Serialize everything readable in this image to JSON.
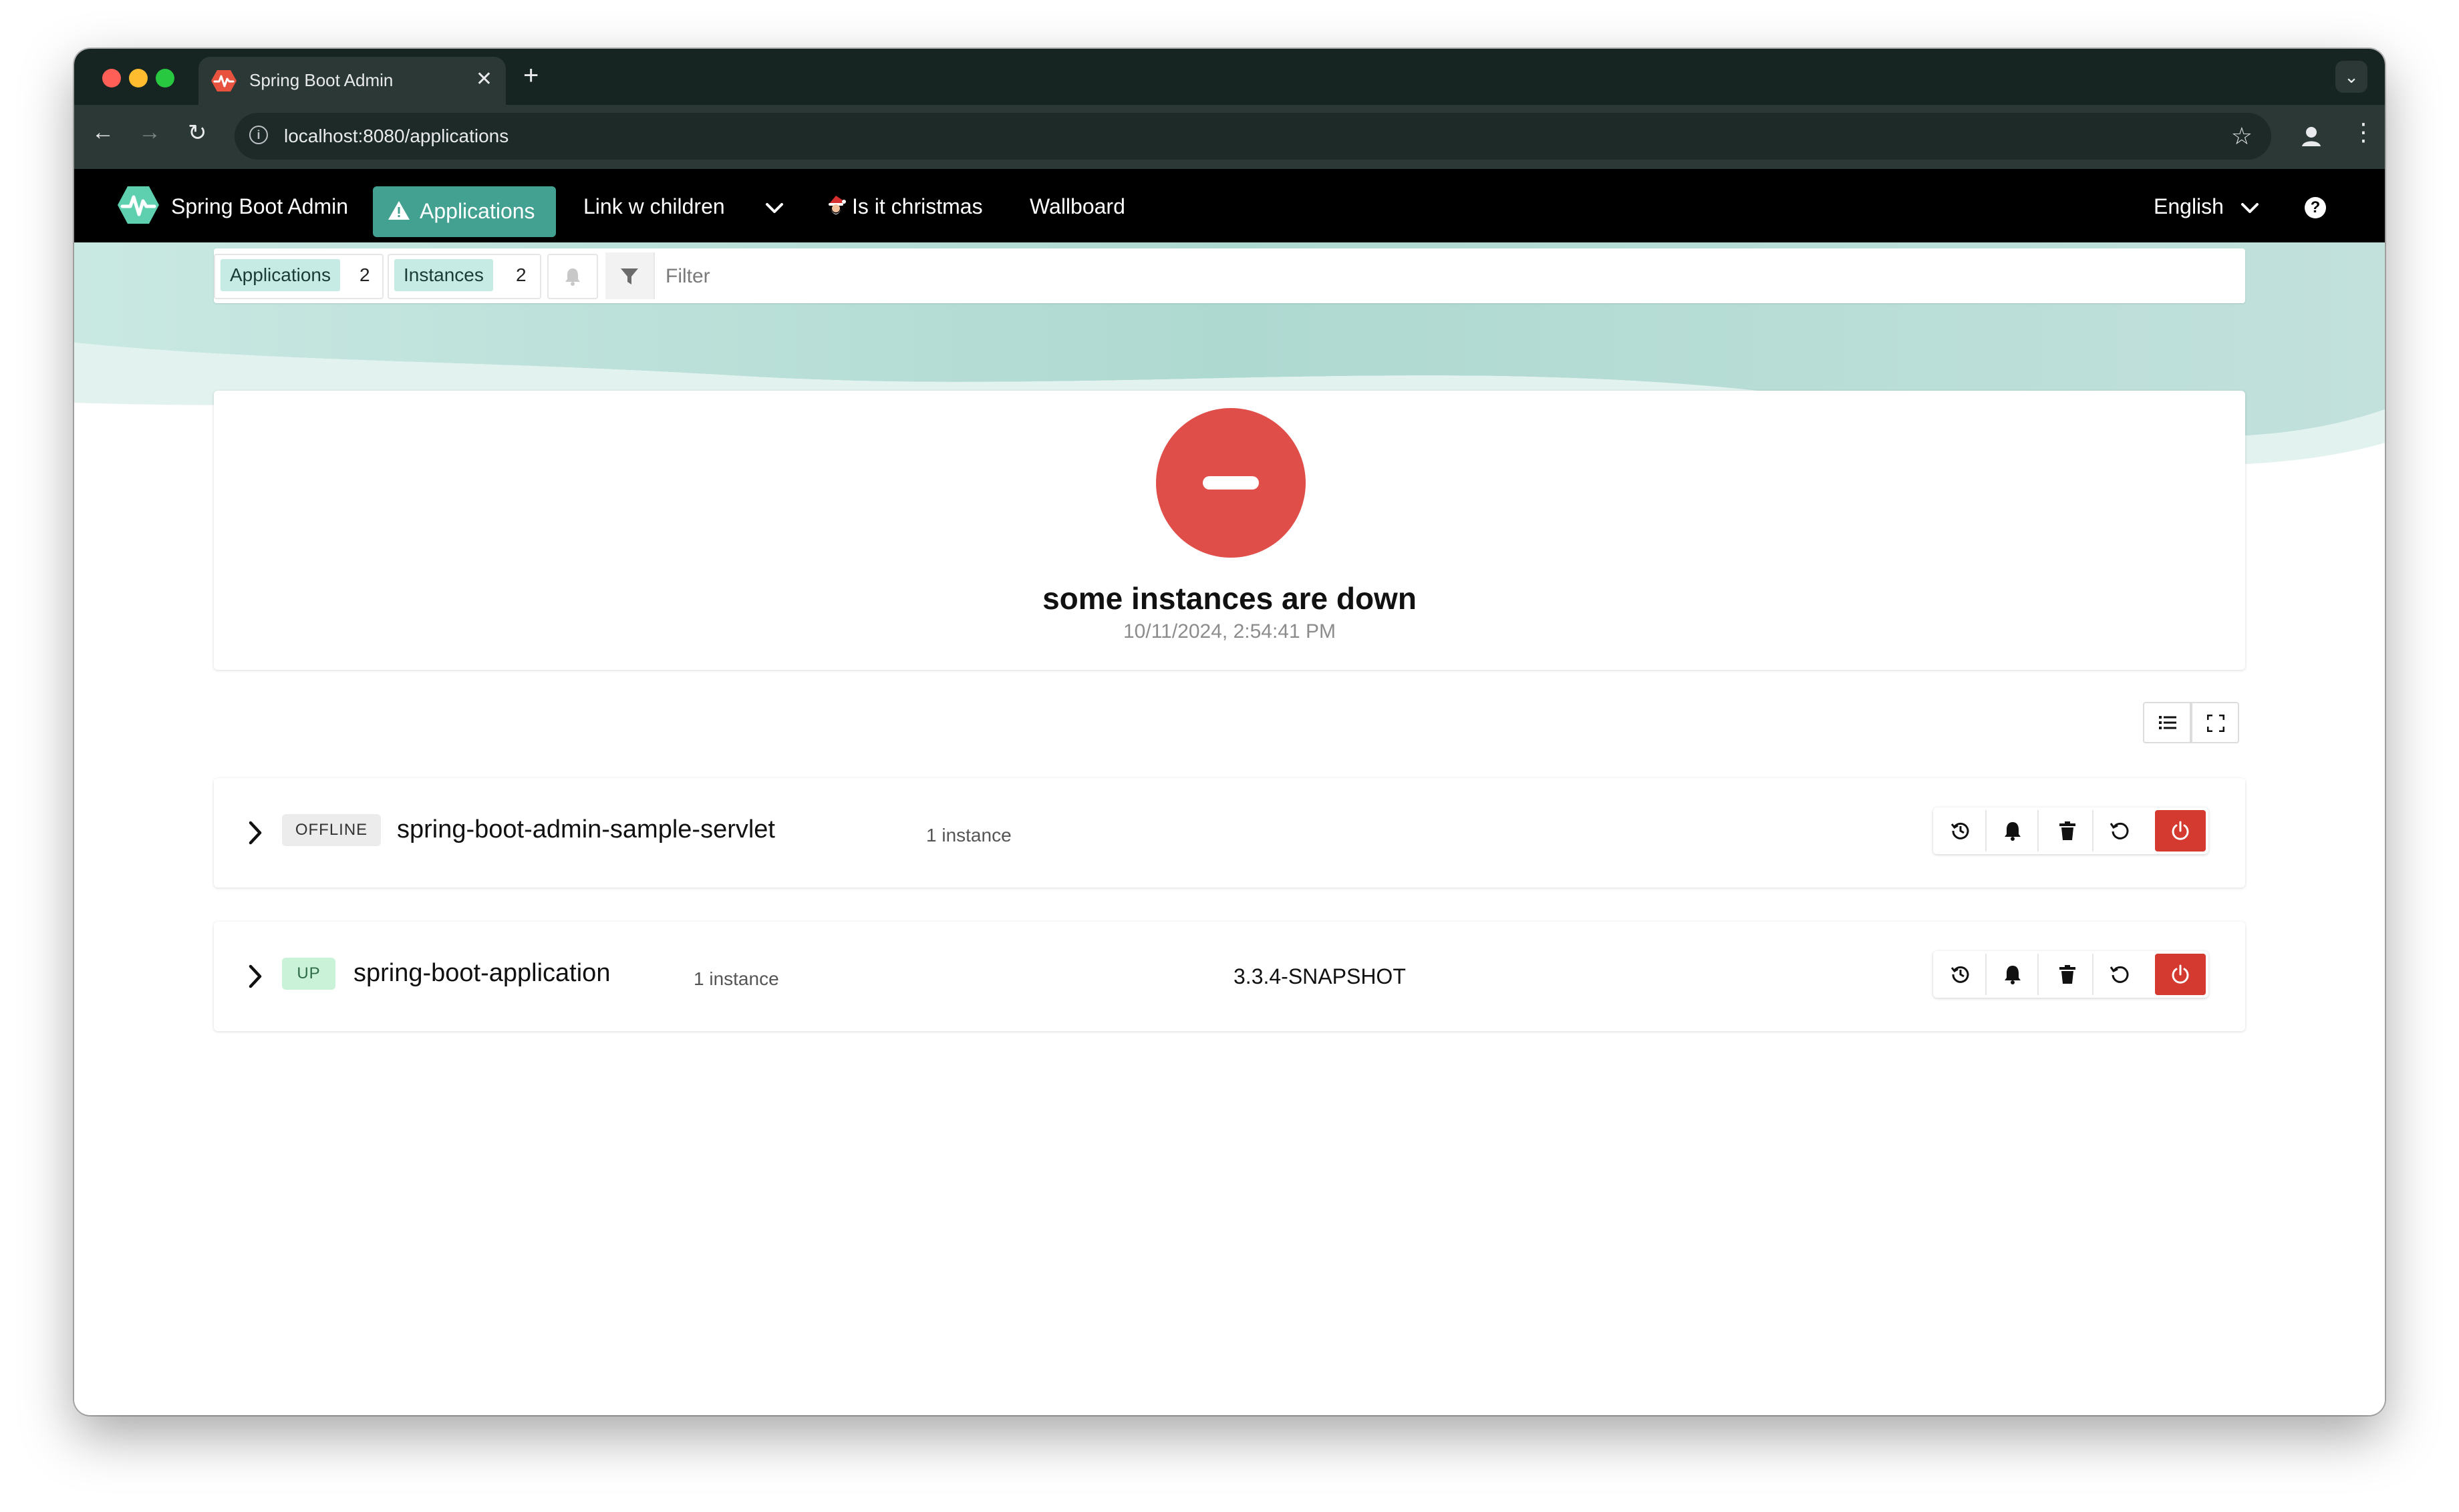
{
  "browser": {
    "tab_title": "Spring Boot Admin",
    "new_tab_label": "+",
    "url": "localhost:8080/applications"
  },
  "nav": {
    "brand": "Spring Boot Admin",
    "items": [
      {
        "label": "Applications",
        "active": true
      },
      {
        "label": "Link w children"
      },
      {
        "label": "Is it christmas"
      },
      {
        "label": "Wallboard"
      }
    ],
    "language": "English",
    "accent_color": "#42a191"
  },
  "filterbar": {
    "applications_label": "Applications",
    "applications_count": "2",
    "instances_label": "Instances",
    "instances_count": "2",
    "filter_placeholder": "Filter"
  },
  "status": {
    "title": "some instances are down",
    "timestamp": "10/11/2024, 2:54:41 PM",
    "color": "#e04e4a"
  },
  "applications": [
    {
      "status": "OFFLINE",
      "name": "spring-boot-admin-sample-servlet",
      "instances": "1 instance",
      "version": ""
    },
    {
      "status": "UP",
      "name": "spring-boot-application",
      "instances": "1 instance",
      "version": "3.3.4-SNAPSHOT"
    }
  ],
  "icons": [
    "spring-boot-logo-icon",
    "warning-icon",
    "chevron-down-icon",
    "santa-icon",
    "help-icon",
    "bell-icon",
    "filter-icon",
    "list-icon",
    "expand-icon",
    "history-icon",
    "trash-icon",
    "restart-icon",
    "power-icon"
  ]
}
